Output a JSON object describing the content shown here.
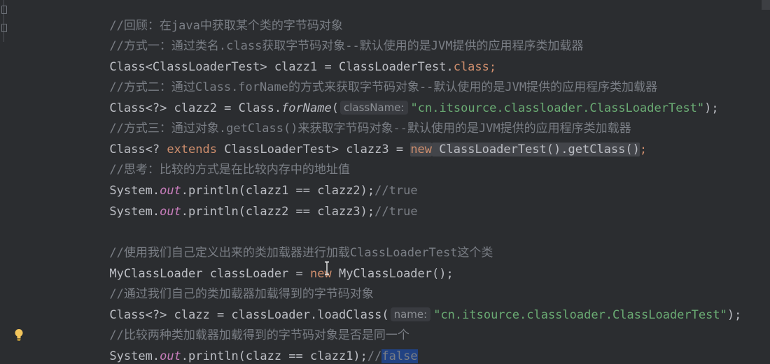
{
  "editor": {
    "lines": [
      {
        "comment": "//回顾：在java中获取某个类的字节码对象"
      },
      {
        "comment": "//方式一：通过类名.class获取字节码对象--默认使用的是JVM提供的应用程序类加载器"
      },
      {
        "p1": "Class<ClassLoaderTest> clazz1 = ClassLoaderTest.",
        "kw": "class",
        "p2": ";"
      },
      {
        "comment": "//方式二：通过Class.forName的方式来获取字节码对象--默认使用的是JVM提供的应用程序类加载器"
      },
      {
        "p1": "Class<?> clazz2 = Class.",
        "method": "forName",
        "p2": "(",
        "hint": "className:",
        "str": "\"cn.itsource.classloader.ClassLoaderTest\"",
        "p3": ");"
      },
      {
        "comment": "//方式三：通过对象.getClass()来获取字节码对象--默认使用的是JVM提供的应用程序类加载器"
      },
      {
        "p1": "Class<? ",
        "kw1": "extends",
        "p2": " ClassLoaderTest> clazz3 = ",
        "kw2": "new",
        "p3": " ClassLoaderTest().getClass()",
        "p4": ";"
      },
      {
        "comment": "//思考：比较的方式是在比较内存中的地址值"
      },
      {
        "p1": "System.",
        "field": "out",
        "p2": ".println(clazz1 == clazz2);",
        "comment": "//true"
      },
      {
        "p1": "System.",
        "field": "out",
        "p2": ".println(clazz2 == clazz3);",
        "comment": "//true"
      },
      {
        "comment": "//使用我们自己定义出来的类加载器进行加载ClassLoaderTest这个类"
      },
      {
        "p1": "MyClassLoader classLoader = ",
        "kw": "new",
        "p2": " MyClassLoader();"
      },
      {
        "comment": "//通过我们自己的类加载器加载得到的字节码对象"
      },
      {
        "p1": "Class<?> clazz = classLoader.loadClass(",
        "hint": "name:",
        "str": "\"cn.itsource.classloader.ClassLoaderTest\"",
        "p2": ");"
      },
      {
        "comment": "//比较两种类加载器加载得到的字节码对象是否是同一个"
      },
      {
        "p1": "System.",
        "field": "out",
        "p2": ".println(clazz == clazz1);",
        "comment": "//",
        "selected": "false"
      }
    ]
  },
  "icons": {
    "gutter_bulb": "lightbulb-icon",
    "text_cursor": "ibeam-cursor-icon",
    "fold": "fold-marker-icon"
  },
  "colors": {
    "background": "#2b2d30",
    "comment": "#7a7e85",
    "keyword": "#cf8e6d",
    "string": "#6aab73",
    "field": "#c77dbb",
    "selection": "#214283"
  }
}
